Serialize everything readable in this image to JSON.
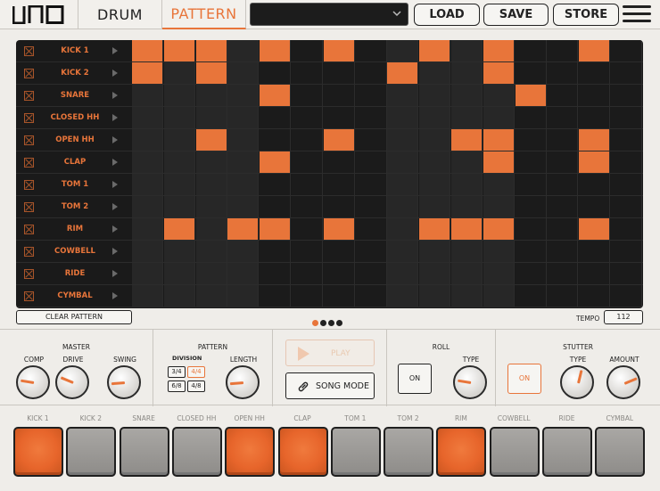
{
  "header": {
    "tabs": [
      {
        "label": "DRUM",
        "active": false
      },
      {
        "label": "PATTERN",
        "active": true
      }
    ],
    "pattern_select_value": "",
    "buttons": {
      "load": "LOAD",
      "save": "SAVE",
      "store": "STORE"
    },
    "accent_color": "#e8753a"
  },
  "grid": {
    "steps": 16,
    "rows": [
      {
        "name": "KICK 1",
        "steps": [
          1,
          1,
          1,
          0,
          1,
          0,
          1,
          0,
          0,
          1,
          0,
          1,
          0,
          0,
          1,
          0
        ]
      },
      {
        "name": "KICK 2",
        "steps": [
          1,
          0,
          1,
          0,
          0,
          0,
          0,
          0,
          1,
          0,
          0,
          1,
          0,
          0,
          0,
          0
        ]
      },
      {
        "name": "SNARE",
        "steps": [
          0,
          0,
          0,
          0,
          1,
          0,
          0,
          0,
          0,
          0,
          0,
          0,
          1,
          0,
          0,
          0
        ]
      },
      {
        "name": "CLOSED HH",
        "steps": [
          0,
          0,
          0,
          0,
          0,
          0,
          0,
          0,
          0,
          0,
          0,
          0,
          0,
          0,
          0,
          0
        ]
      },
      {
        "name": "OPEN HH",
        "steps": [
          0,
          0,
          1,
          0,
          0,
          0,
          1,
          0,
          0,
          0,
          1,
          1,
          0,
          0,
          1,
          0
        ]
      },
      {
        "name": "CLAP",
        "steps": [
          0,
          0,
          0,
          0,
          1,
          0,
          0,
          0,
          0,
          0,
          0,
          1,
          0,
          0,
          1,
          0
        ]
      },
      {
        "name": "TOM 1",
        "steps": [
          0,
          0,
          0,
          0,
          0,
          0,
          0,
          0,
          0,
          0,
          0,
          0,
          0,
          0,
          0,
          0
        ]
      },
      {
        "name": "TOM 2",
        "steps": [
          0,
          0,
          0,
          0,
          0,
          0,
          0,
          0,
          0,
          0,
          0,
          0,
          0,
          0,
          0,
          0
        ]
      },
      {
        "name": "RIM",
        "steps": [
          0,
          1,
          0,
          1,
          1,
          0,
          1,
          0,
          0,
          1,
          1,
          1,
          0,
          0,
          1,
          0
        ]
      },
      {
        "name": "COWBELL",
        "steps": [
          0,
          0,
          0,
          0,
          0,
          0,
          0,
          0,
          0,
          0,
          0,
          0,
          0,
          0,
          0,
          0
        ]
      },
      {
        "name": "RIDE",
        "steps": [
          0,
          0,
          0,
          0,
          0,
          0,
          0,
          0,
          0,
          0,
          0,
          0,
          0,
          0,
          0,
          0
        ]
      },
      {
        "name": "CYMBAL",
        "steps": [
          0,
          0,
          0,
          0,
          0,
          0,
          0,
          0,
          0,
          0,
          0,
          0,
          0,
          0,
          0,
          0
        ]
      }
    ],
    "clear_label": "CLEAR PATTERN",
    "pages": 4,
    "active_page": 1,
    "tempo_label": "TEMPO",
    "tempo_value": "112"
  },
  "master": {
    "title": "MASTER",
    "knobs": [
      {
        "label": "COMP",
        "value": 0.2
      },
      {
        "label": "DRIVE",
        "value": 0.25
      },
      {
        "label": "SWING",
        "value": 0.15
      }
    ]
  },
  "pattern": {
    "title": "PATTERN",
    "division_label": "DIVISION",
    "divisions": [
      "3/4",
      "4/4",
      "6/8",
      "4/8"
    ],
    "selected_division": "4/4",
    "length_label": "LENGTH",
    "length_value": 0.15
  },
  "transport": {
    "play_label": "PLAY",
    "song_mode_label": "SONG MODE"
  },
  "roll": {
    "title": "ROLL",
    "on_label": "ON",
    "type_label": "TYPE",
    "type_value": 0.2
  },
  "stutter": {
    "title": "STUTTER",
    "on_label": "ON",
    "type_label": "TYPE",
    "type_value": 0.55,
    "amount_label": "AMOUNT",
    "amount_value": 0.75
  },
  "pads": [
    {
      "label": "KICK 1",
      "lit": true
    },
    {
      "label": "KICK 2",
      "lit": false
    },
    {
      "label": "SNARE",
      "lit": false
    },
    {
      "label": "CLOSED HH",
      "lit": false
    },
    {
      "label": "OPEN HH",
      "lit": true
    },
    {
      "label": "CLAP",
      "lit": true
    },
    {
      "label": "TOM 1",
      "lit": false
    },
    {
      "label": "TOM 2",
      "lit": false
    },
    {
      "label": "RIM",
      "lit": true
    },
    {
      "label": "COWBELL",
      "lit": false
    },
    {
      "label": "RIDE",
      "lit": false
    },
    {
      "label": "CYMBAL",
      "lit": false
    }
  ]
}
